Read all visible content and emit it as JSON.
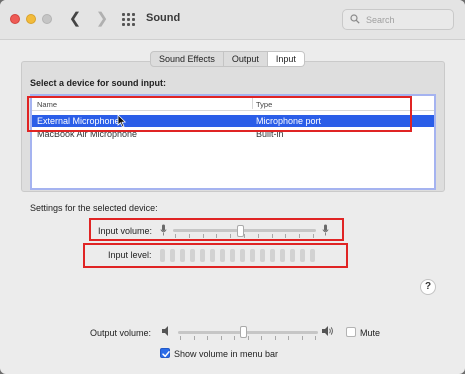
{
  "window": {
    "title": "Sound"
  },
  "search": {
    "placeholder": "Search"
  },
  "tabs": [
    {
      "label": "Sound Effects",
      "active": false
    },
    {
      "label": "Output",
      "active": false
    },
    {
      "label": "Input",
      "active": true
    }
  ],
  "input_section": {
    "heading": "Select a device for sound input:",
    "columns": [
      "Name",
      "Type"
    ],
    "devices": [
      {
        "name": "External Microphone",
        "type": "Microphone port",
        "selected": true
      },
      {
        "name": "MacBook Air Microphone",
        "type": "Built-in",
        "selected": false
      }
    ]
  },
  "device_settings": {
    "heading": "Settings for the selected device:",
    "input_volume_label": "Input volume:",
    "input_volume_fraction": 0.47,
    "input_level_label": "Input level:",
    "input_level_segments_lit": 0
  },
  "help": {
    "label": "?"
  },
  "output": {
    "volume_label": "Output volume:",
    "volume_fraction": 0.47,
    "mute_label": "Mute",
    "mute_checked": false,
    "menu_bar_label": "Show volume in menu bar",
    "menu_bar_checked": true
  },
  "colors": {
    "selection": "#2b5ee8",
    "highlight_box": "#e02424",
    "checkbox_accent": "#2b6ce8"
  }
}
